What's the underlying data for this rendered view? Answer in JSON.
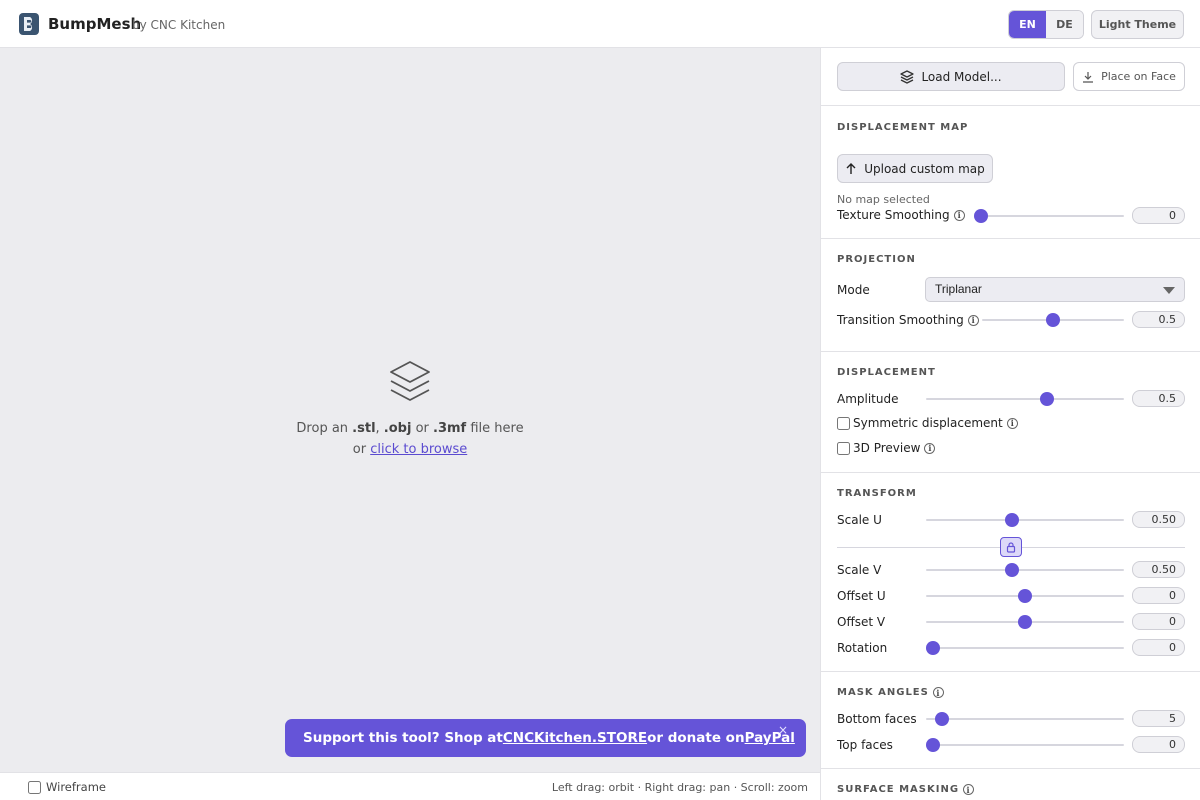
{
  "header": {
    "brand": "BumpMesh",
    "brand_sub": "by CNC Kitchen",
    "lang_en": "EN",
    "lang_de": "DE",
    "theme_button": "Light Theme"
  },
  "viewport": {
    "drop_prefix": "Drop an ",
    "ext_stl": ".stl",
    "sep1": ", ",
    "ext_obj": ".obj",
    "or1": " or ",
    "ext_3mf": ".3mf",
    "drop_suffix": " file here",
    "or2": "or ",
    "browse_link": "click to browse",
    "banner_prefix": "Support this tool? Shop at ",
    "banner_store": "CNCKitchen.STORE",
    "banner_mid": " or donate on ",
    "banner_paypal": "PayPal",
    "banner_close": "×",
    "wireframe": "Wireframe",
    "hints": "Left drag: orbit  ·  Right drag: pan  ·  Scroll: zoom"
  },
  "panel": {
    "load_model": "Load Model...",
    "place_on_face": "Place on Face",
    "displacement_map": {
      "title": "DISPLACEMENT MAP",
      "upload": "Upload custom map",
      "no_map": "No map selected",
      "texture_smoothing": "Texture Smoothing",
      "texture_smoothing_value": "0",
      "texture_smoothing_fraction": 0.0
    },
    "projection": {
      "title": "PROJECTION",
      "mode_label": "Mode",
      "mode_value": "Triplanar",
      "transition_smoothing": "Transition Smoothing",
      "transition_smoothing_value": "0.5",
      "transition_smoothing_fraction": 0.5
    },
    "displacement": {
      "title": "DISPLACEMENT",
      "amplitude": "Amplitude",
      "amplitude_value": "0.5",
      "amplitude_fraction": 0.62,
      "symmetric": "Symmetric displacement",
      "preview3d": "3D Preview"
    },
    "transform": {
      "title": "TRANSFORM",
      "scale_u": "Scale U",
      "scale_u_value": "0.50",
      "scale_u_fraction": 0.43,
      "scale_v": "Scale V",
      "scale_v_value": "0.50",
      "scale_v_fraction": 0.43,
      "offset_u": "Offset U",
      "offset_u_value": "0",
      "offset_u_fraction": 0.5,
      "offset_v": "Offset V",
      "offset_v_value": "0",
      "offset_v_fraction": 0.5,
      "rotation": "Rotation",
      "rotation_value": "0",
      "rotation_fraction": 0.0
    },
    "mask_angles": {
      "title": "MASK ANGLES",
      "bottom_faces": "Bottom faces",
      "bottom_faces_value": "5",
      "bottom_faces_fraction": 0.05,
      "top_faces": "Top faces",
      "top_faces_value": "0",
      "top_faces_fraction": 0.0
    },
    "surface_masking": {
      "title": "SURFACE MASKING"
    }
  },
  "colors": {
    "accent": "#6554d8"
  }
}
